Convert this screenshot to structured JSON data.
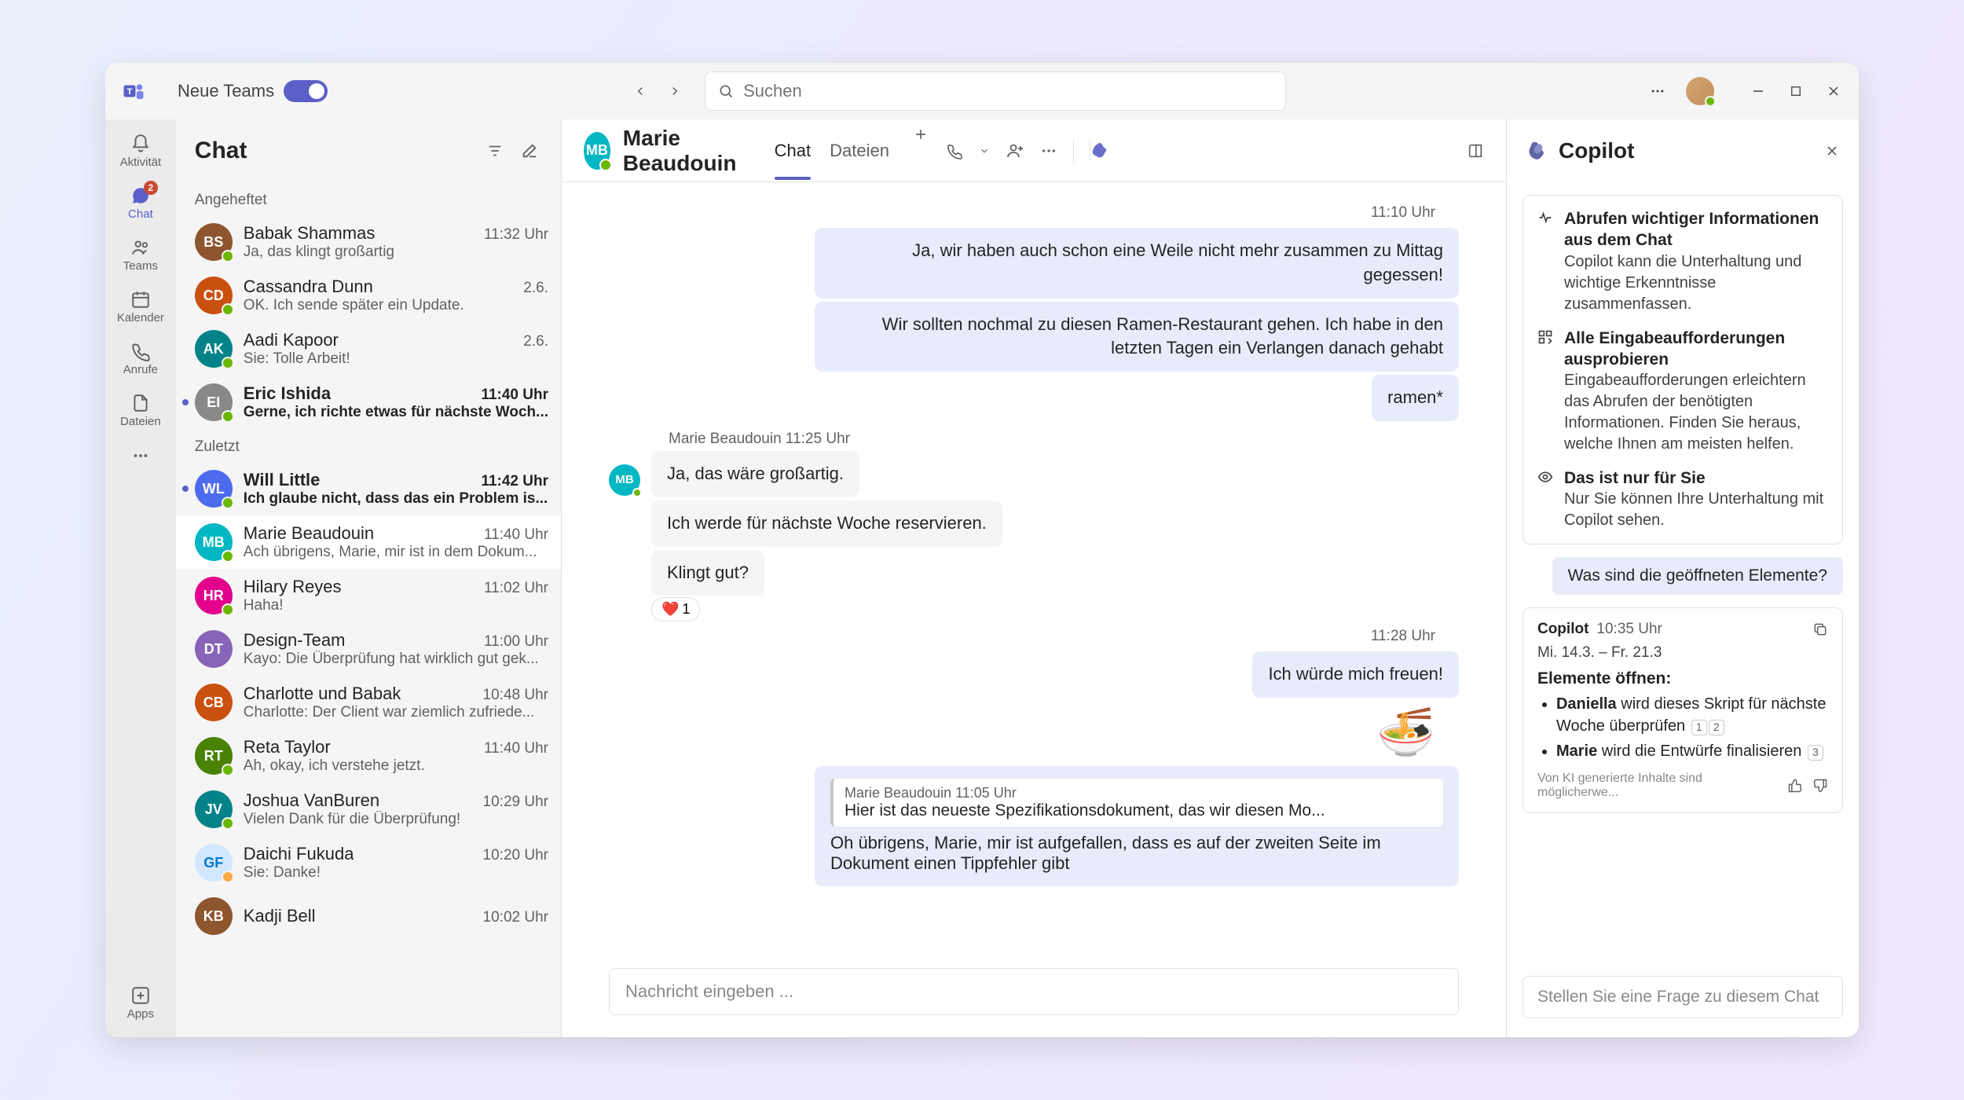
{
  "titlebar": {
    "toggle_label": "Neue Teams",
    "search_placeholder": "Suchen"
  },
  "rail": {
    "activity": "Aktivität",
    "chat": "Chat",
    "chat_badge": "2",
    "teams": "Teams",
    "calendar": "Kalender",
    "calls": "Anrufe",
    "files": "Dateien",
    "apps": "Apps"
  },
  "chatlist": {
    "title": "Chat",
    "sections": {
      "pinned": "Angeheftet",
      "recent": "Zuletzt"
    },
    "pinned": [
      {
        "name": "Babak Shammas",
        "time": "11:32 Uhr",
        "preview": "Ja, das klingt großartig",
        "initials": "BS"
      },
      {
        "name": "Cassandra Dunn",
        "time": "2.6.",
        "preview": "OK. Ich sende später ein Update.",
        "initials": "CD"
      },
      {
        "name": "Aadi Kapoor",
        "time": "2.6.",
        "preview": "Sie: Tolle Arbeit!",
        "initials": "AK"
      },
      {
        "name": "Eric Ishida",
        "time": "11:40 Uhr",
        "preview": "Gerne, ich richte etwas für nächste Woch...",
        "initials": "EI"
      }
    ],
    "recent": [
      {
        "name": "Will Little",
        "time": "11:42 Uhr",
        "preview": "Ich glaube nicht, dass das ein Problem is...",
        "initials": "WL"
      },
      {
        "name": "Marie Beaudouin",
        "time": "11:40 Uhr",
        "preview": "Ach übrigens, Marie, mir ist in dem Dokum...",
        "initials": "MB"
      },
      {
        "name": "Hilary Reyes",
        "time": "11:02 Uhr",
        "preview": "Haha!",
        "initials": "HR"
      },
      {
        "name": "Design-Team",
        "time": "11:00 Uhr",
        "preview": "Kayo: Die Überprüfung hat wirklich gut gek...",
        "initials": "DT"
      },
      {
        "name": "Charlotte und Babak",
        "time": "10:48 Uhr",
        "preview": "Charlotte: Der Client war ziemlich zufriede...",
        "initials": "CB"
      },
      {
        "name": "Reta Taylor",
        "time": "11:40 Uhr",
        "preview": "Ah, okay, ich verstehe jetzt.",
        "initials": "RT"
      },
      {
        "name": "Joshua VanBuren",
        "time": "10:29 Uhr",
        "preview": "Vielen Dank für die Überprüfung!",
        "initials": "JV"
      },
      {
        "name": "Daichi Fukuda",
        "time": "10:20 Uhr",
        "preview": "Sie: Danke!",
        "initials": "GF"
      },
      {
        "name": "Kadji Bell",
        "time": "10:02 Uhr",
        "preview": "",
        "initials": "KB"
      }
    ]
  },
  "conv": {
    "title": "Marie Beaudouin",
    "avatar_initials": "MB",
    "tabs": {
      "chat": "Chat",
      "files": "Dateien"
    },
    "time1": "11:10 Uhr",
    "out1": "Ja, wir haben auch schon eine Weile nicht mehr zusammen zu Mittag gegessen!",
    "out2": "Wir sollten nochmal zu diesen Ramen-Restaurant gehen. Ich habe in den letzten Tagen ein Verlangen danach gehabt",
    "out3": "ramen*",
    "sender_line": "Marie Beaudouin   11:25 Uhr",
    "in1": "Ja, das wäre großartig.",
    "in2": "Ich werde für nächste Woche reservieren.",
    "in3": "Klingt gut?",
    "reaction_count": "1",
    "time2": "11:28 Uhr",
    "out4": "Ich würde mich freuen!",
    "emoji": "🍜",
    "quote_sender": "Marie Beaudouin   11:05 Uhr",
    "quote_text": "Hier ist das neueste Spezifikationsdokument, das wir diesen Mo...",
    "quote_body": "Oh übrigens, Marie, mir ist aufgefallen, dass es auf der zweiten Seite im Dokument einen Tippfehler gibt",
    "compose_placeholder": "Nachricht eingeben ..."
  },
  "copilot": {
    "title": "Copilot",
    "tips": [
      {
        "title": "Abrufen wichtiger Informationen aus dem Chat",
        "body": "Copilot kann die Unterhaltung und wichtige Erkenntnisse zusammenfassen."
      },
      {
        "title": "Alle Eingabeaufforderungen ausprobieren",
        "body": "Eingabeaufforderungen erleichtern das Abrufen der benötigten Informationen. Finden Sie heraus, welche Ihnen am meisten helfen."
      },
      {
        "title": "Das ist nur für Sie",
        "body": "Nur Sie können Ihre Unterhaltung mit Copilot sehen."
      }
    ],
    "suggestion": "Was sind die geöffneten Elemente?",
    "response": {
      "name": "Copilot",
      "time": "10:35 Uhr",
      "date_range": "Mi. 14.3. – Fr. 21.3",
      "heading": "Elemente öffnen:",
      "items": [
        {
          "who": "Daniella",
          "text": " wird dieses Skript für nächste Woche überprüfen ",
          "refs": [
            "1",
            "2"
          ]
        },
        {
          "who": "Marie",
          "text": " wird die Entwürfe finalisieren ",
          "refs": [
            "3"
          ]
        }
      ],
      "disclaimer": "Von KI generierte Inhalte sind möglicherwe..."
    },
    "compose_placeholder": "Stellen Sie eine Frage zu diesem Chat"
  }
}
